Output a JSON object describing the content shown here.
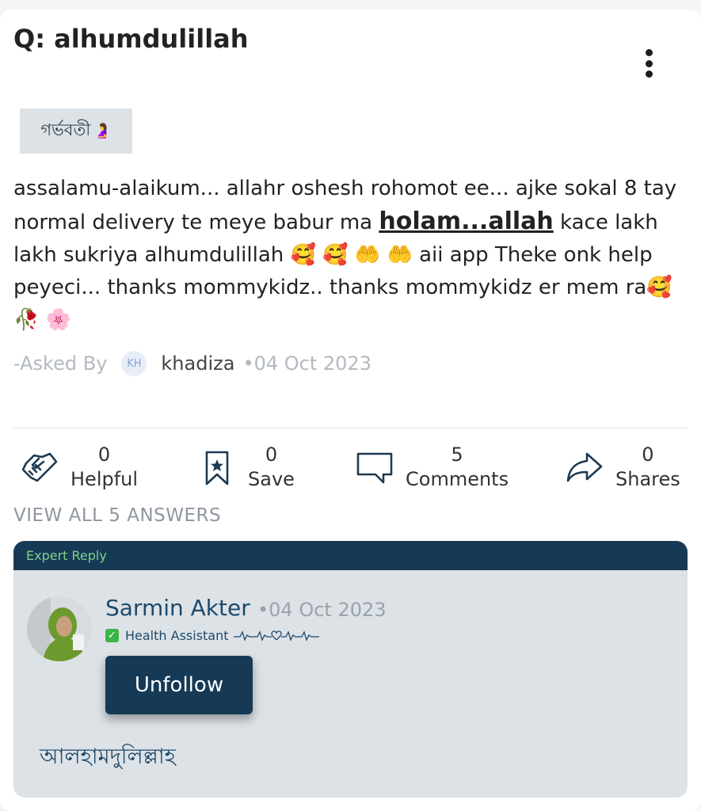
{
  "question": {
    "title": "Q: alhumdulillah",
    "tag": "গর্ভবতী",
    "tag_emoji": "🤰",
    "body_part1": "assalamu-alaikum... allahr oshesh rohomot ee... ajke sokal 8 tay normal delivery te meye babur ma ",
    "body_bold": "holam...allah",
    "body_part2": " kace lakh lakh sukriya alhumdulillah 🥰 🥰 🤲 🤲 aii app Theke onk help peyeci... thanks mommykidz.. thanks mommykidz er mem ra🥰 🥀 🌸",
    "asked_label": "-Asked By",
    "asker_initials": "KH",
    "asker_name": "khadiza",
    "date": "•04 Oct 2023"
  },
  "actions": {
    "helpful_count": "0",
    "helpful_label": "Helpful",
    "save_count": "0",
    "save_label": "Save",
    "comments_count": "5",
    "comments_label": "Comments",
    "shares_count": "0",
    "shares_label": "Shares"
  },
  "view_all": "VIEW ALL 5 ANSWERS",
  "reply": {
    "header": "Expert Reply",
    "name": "Sarmin Akter",
    "date": "•04 Oct 2023",
    "role": "Health Assistant",
    "follow_button": "Unfollow",
    "text": "আলহামদুলিল্লাহ"
  },
  "colors": {
    "accent": "#163a56",
    "expert_label": "#7fd08a",
    "reply_bg": "#dde2e7"
  }
}
